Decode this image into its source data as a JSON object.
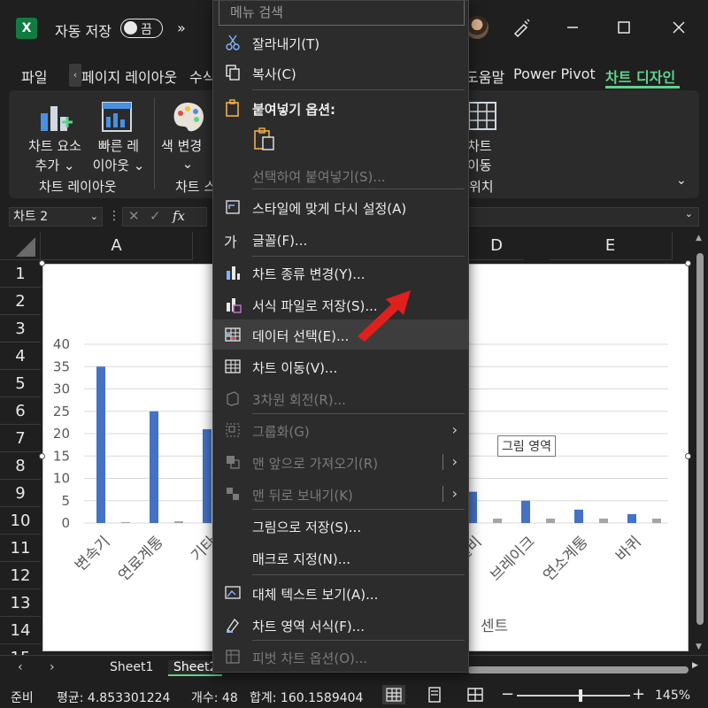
{
  "titlebar": {
    "logo": "X",
    "autosave_label": "자동 저장",
    "toggle_state": "끔",
    "more": "»",
    "icons": [
      "excel-logo-icon",
      "avatar",
      "pen-icon",
      "minimize-icon",
      "maximize-icon",
      "close-icon"
    ]
  },
  "tabs": {
    "items": [
      "파일",
      "페이지 레이아웃",
      "수식",
      "도움말",
      "Power Pivot",
      "차트 디자인"
    ],
    "active": "차트 디자인"
  },
  "ribbon": {
    "chart_elements": [
      "차트 요소",
      "추가 ⌄"
    ],
    "quick_layout": [
      "빠른 레",
      "이아웃 ⌄"
    ],
    "change_colors": [
      "색 변경",
      "⌄"
    ],
    "group_layout": "차트 레이아웃",
    "group_styles_partial": "차트 스",
    "move_chart": [
      "차트",
      "이동"
    ],
    "group_location_partial": "위치"
  },
  "formula": {
    "namebox": "차트 2",
    "fx": "fx"
  },
  "grid": {
    "columns": [
      "A",
      "D",
      "E"
    ],
    "rows": [
      "1",
      "2",
      "3",
      "4",
      "5",
      "6",
      "7",
      "8",
      "9",
      "10",
      "11",
      "12",
      "13",
      "14",
      "15"
    ]
  },
  "chart_data": {
    "type": "bar",
    "categories": [
      "변속기",
      "연료계통",
      "기타",
      "",
      "",
      "",
      "",
      "설비",
      "브레이크",
      "연소계통",
      "바퀴"
    ],
    "series": [
      {
        "values": [
          35,
          25,
          21,
          0,
          0,
          0,
          0,
          7,
          5,
          3,
          2
        ],
        "color": "#4472c4"
      },
      {
        "values": [
          0.2,
          0.4,
          0.5,
          0,
          0,
          0,
          0,
          1,
          1,
          1,
          1
        ],
        "color": "#a5a5a5"
      }
    ],
    "y_ticks": [
      "0",
      "5",
      "10",
      "15",
      "20",
      "25",
      "30",
      "35",
      "40"
    ],
    "ylim": [
      0,
      40
    ],
    "grid": true,
    "xlabel_partial": "센트",
    "tooltip": "그림 영역"
  },
  "menu": {
    "search_placeholder": "메뉴 검색",
    "items": [
      {
        "label": "잘라내기(T)",
        "icon": "scissors-icon",
        "disabled": false
      },
      {
        "label": "복사(C)",
        "icon": "copy-icon",
        "disabled": false
      },
      {
        "label": "붙여넣기 옵션:",
        "icon": "paste-icon",
        "disabled": false,
        "bold": true
      },
      {
        "label": "선택하여 붙여넣기(S)...",
        "icon": "",
        "disabled": true
      },
      {
        "label": "스타일에 맞게 다시 설정(A)",
        "icon": "reset-style-icon",
        "disabled": false
      },
      {
        "label": "글꼴(F)...",
        "icon": "font-icon",
        "icon_glyph": "가",
        "disabled": false
      },
      {
        "label": "차트 종류 변경(Y)...",
        "icon": "chart-type-icon",
        "disabled": false
      },
      {
        "label": "서식 파일로 저장(S)...",
        "icon": "save-template-icon",
        "disabled": false
      },
      {
        "label": "데이터 선택(E)...",
        "icon": "select-data-icon",
        "disabled": false,
        "hover": true
      },
      {
        "label": "차트 이동(V)...",
        "icon": "move-chart-icon",
        "disabled": false
      },
      {
        "label": "3차원 회전(R)...",
        "icon": "rotate-3d-icon",
        "disabled": true
      },
      {
        "label": "그룹화(G)",
        "icon": "group-icon",
        "disabled": true,
        "submenu": true
      },
      {
        "label": "맨 앞으로 가져오기(R)",
        "icon": "bring-front-icon",
        "disabled": true,
        "submenu": true,
        "split": true
      },
      {
        "label": "맨 뒤로 보내기(K)",
        "icon": "send-back-icon",
        "disabled": true,
        "submenu": true,
        "split": true
      },
      {
        "label": "그림으로 저장(S)...",
        "icon": "",
        "disabled": false
      },
      {
        "label": "매크로 지정(N)...",
        "icon": "",
        "disabled": false
      },
      {
        "label": "대체 텍스트 보기(A)...",
        "icon": "alt-text-icon",
        "disabled": false
      },
      {
        "label": "차트 영역 서식(F)...",
        "icon": "format-chart-icon",
        "disabled": false
      },
      {
        "label": "피벗 차트 옵션(O)...",
        "icon": "pivot-chart-icon",
        "disabled": true
      }
    ]
  },
  "sheets": {
    "tabs": [
      "Sheet1",
      "Sheet2"
    ],
    "active": "Sheet2"
  },
  "status": {
    "ready": "준비",
    "average": "평균: 4.853301224",
    "count": "개수: 48",
    "sum": "합계: 160.1589404",
    "zoom": "145%",
    "zoom_fraction": 0.56
  },
  "colors": {
    "accent": "#5fd38d",
    "bar_blue": "#4472c4",
    "bar_gray": "#a5a5a5",
    "arrow_red": "#e0201c"
  }
}
